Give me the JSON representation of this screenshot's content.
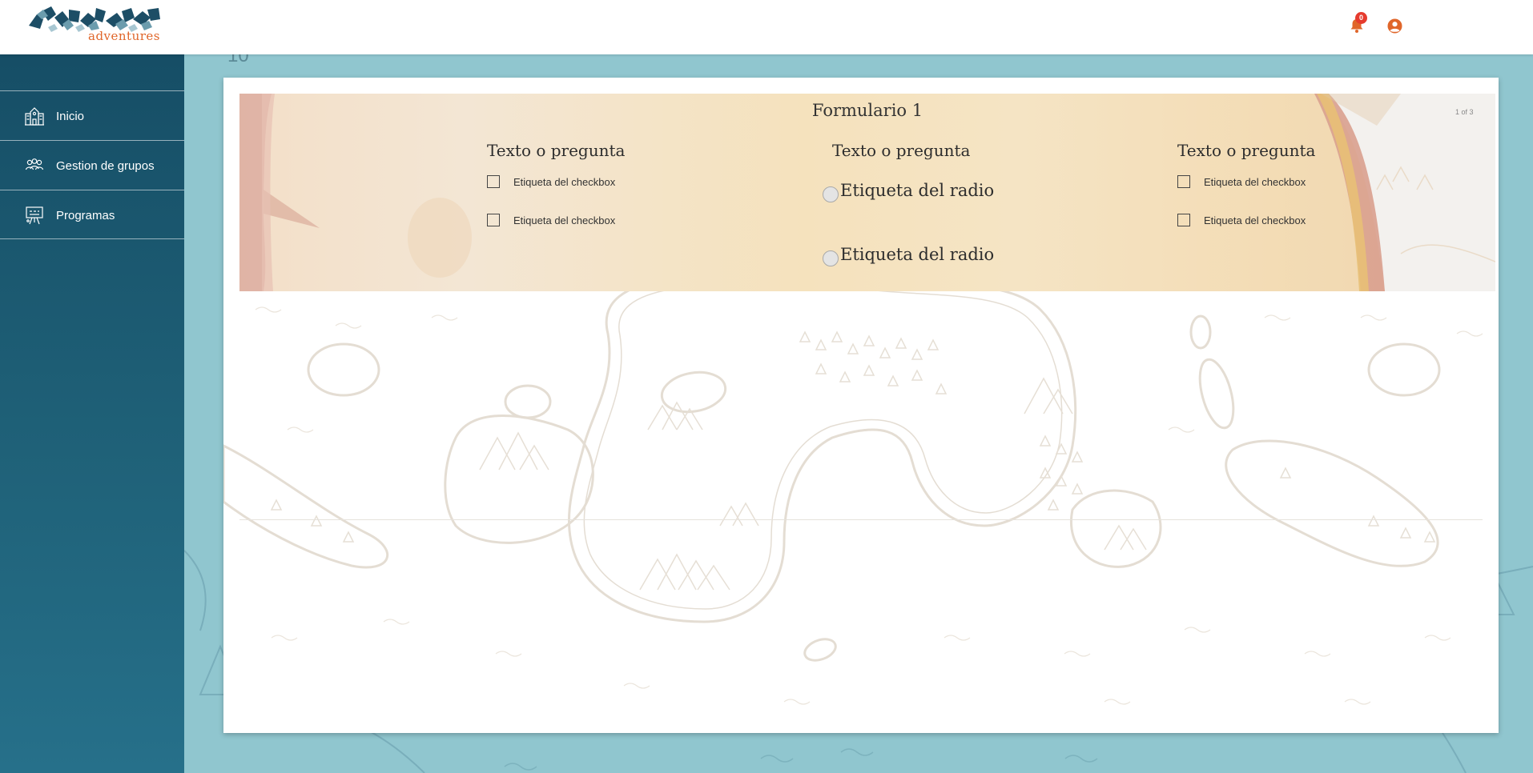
{
  "header": {
    "logo_text": "adventures",
    "notifications_count": "0"
  },
  "page": {
    "number": "10"
  },
  "sidebar": {
    "items": [
      {
        "label": "Inicio",
        "icon": "school-building-icon"
      },
      {
        "label": "Gestion de grupos",
        "icon": "group-icon"
      },
      {
        "label": "Programas",
        "icon": "presentation-board-icon"
      }
    ]
  },
  "form": {
    "title": "Formulario 1",
    "pager": "1 of 3",
    "columns": [
      {
        "question": "Texto o pregunta",
        "type": "checkbox",
        "options": [
          "Etiqueta del checkbox",
          "Etiqueta del checkbox"
        ]
      },
      {
        "question": "Texto o pregunta",
        "type": "radio",
        "options": [
          "Etiqueta del radio",
          "Etiqueta del radio"
        ]
      },
      {
        "question": "Texto o pregunta",
        "type": "checkbox",
        "options": [
          "Etiqueta del checkbox",
          "Etiqueta del checkbox"
        ]
      }
    ]
  },
  "colors": {
    "sidebar": "#164e66",
    "accent_orange": "#e0662a",
    "badge": "#e63b2e",
    "parchment": "#f5e2bd",
    "background": "#90c6cf"
  }
}
